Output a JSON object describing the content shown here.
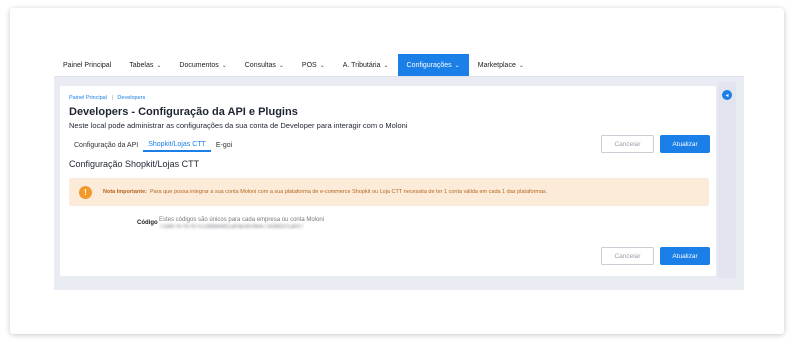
{
  "nav": {
    "items": [
      {
        "label": "Painel Principal",
        "caret": ""
      },
      {
        "label": "Tabelas",
        "caret": "⌄"
      },
      {
        "label": "Documentos",
        "caret": "⌄"
      },
      {
        "label": "Consultas",
        "caret": "⌄"
      },
      {
        "label": "POS",
        "caret": "⌄"
      },
      {
        "label": "A. Tributária",
        "caret": "⌄"
      },
      {
        "label": "Configurações",
        "caret": "⌄"
      },
      {
        "label": "Marketplace",
        "caret": "⌄"
      }
    ],
    "active_index": 6
  },
  "breadcrumb": {
    "home": "Painel Principal",
    "separator": "|",
    "current": "Developers"
  },
  "page": {
    "title": "Developers - Configuração da API e Plugins",
    "subtitle": "Neste local pode administrar as configurações da sua conta de Developer para interagir com o Moloni"
  },
  "tabs": [
    {
      "label": "Configuração da API"
    },
    {
      "label": "Shopkit/Lojas CTT"
    },
    {
      "label": "E-goi"
    }
  ],
  "buttons": {
    "cancel": "Cancelar",
    "update": "Atualizar"
  },
  "section": {
    "title": "Configuração Shopkit/Lojas CTT"
  },
  "alert": {
    "icon": "!",
    "strong": "Nota Importante:",
    "text": "Para que possa integrar a sua conta Moloni com a sua plataforma de e-commerce Shopkit ou Loja CTT necessita de ter 1 conta válida em cada 1 das plataformas."
  },
  "field": {
    "label": "Código",
    "hint": "Estes códigos são únicos para cada empresa ou conta Moloni",
    "value": "71887479797c1d8be6b1a0ac8c9ee7308d1f1a0f7"
  },
  "side_toggle": {
    "icon": "◂"
  },
  "colors": {
    "accent": "#1a7fe6",
    "alert_bg": "#fcebd9",
    "alert_icon": "#f39a2d"
  }
}
